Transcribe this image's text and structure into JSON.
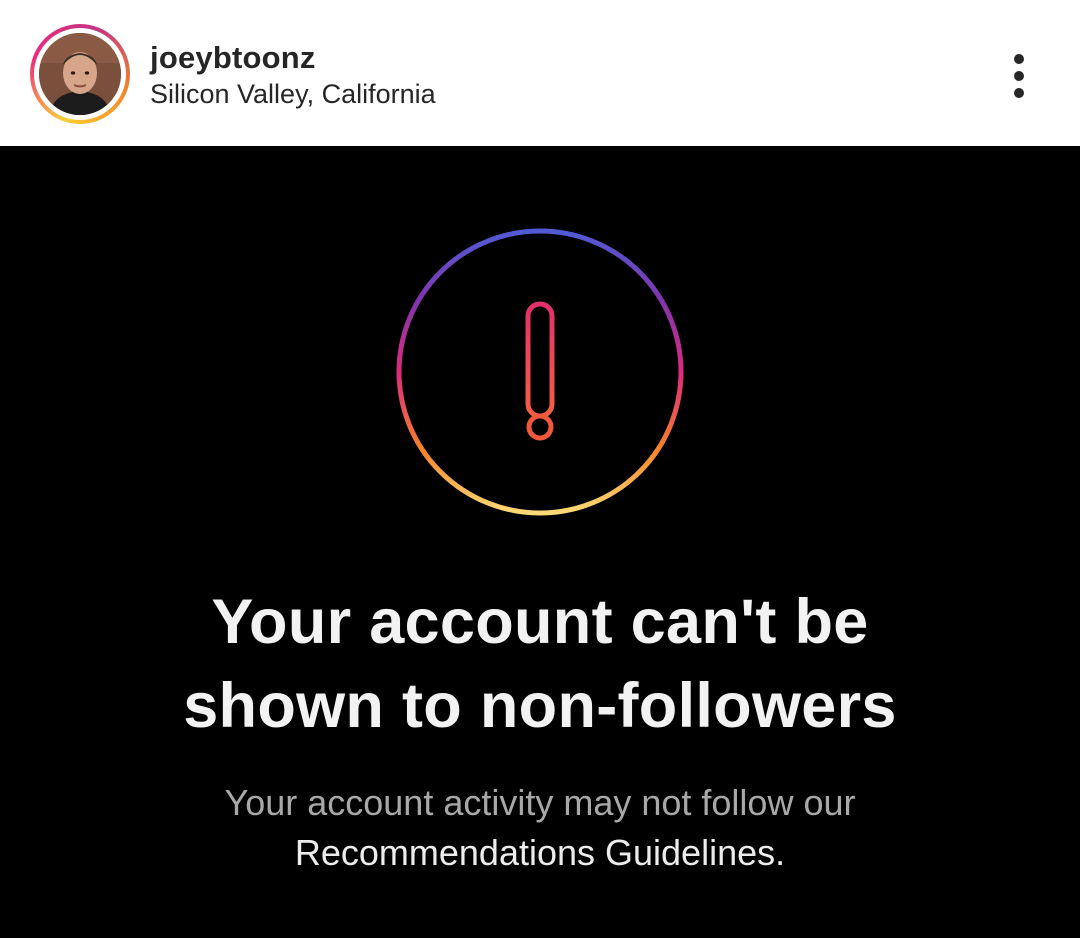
{
  "post": {
    "username": "joeybtoonz",
    "location": "Silicon Valley, California"
  },
  "icons": {
    "avatar": "profile-photo",
    "more": "more-vertical-icon",
    "warning": "exclamation-circle-icon"
  },
  "notice": {
    "headline_line1": "Your account can't be",
    "headline_line2": "shown to non-followers",
    "body_line1": "Your account activity may not follow our",
    "link_text": "Recommendations Guidelines",
    "body_suffix": "."
  },
  "colors": {
    "gradient": [
      "#515bd4",
      "#8134af",
      "#dd2a7b",
      "#f58529",
      "#feda77"
    ],
    "media_background": "#000000",
    "header_background": "#ffffff"
  }
}
